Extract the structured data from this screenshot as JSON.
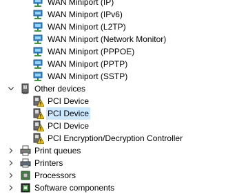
{
  "network_adapters": {
    "items": [
      {
        "label": "WAN Miniport (IP)"
      },
      {
        "label": "WAN Miniport (IPv6)"
      },
      {
        "label": "WAN Miniport (L2TP)"
      },
      {
        "label": "WAN Miniport (Network Monitor)"
      },
      {
        "label": "WAN Miniport (PPPOE)"
      },
      {
        "label": "WAN Miniport (PPTP)"
      },
      {
        "label": "WAN Miniport (SSTP)"
      }
    ]
  },
  "other_devices": {
    "label": "Other devices",
    "items": [
      {
        "label": "PCI Device"
      },
      {
        "label": "PCI Device"
      },
      {
        "label": "PCI Device"
      },
      {
        "label": "PCI Encryption/Decryption Controller"
      }
    ]
  },
  "categories": [
    {
      "label": "Print queues",
      "icon": "print-queue-icon"
    },
    {
      "label": "Printers",
      "icon": "printer-icon"
    },
    {
      "label": "Processors",
      "icon": "processor-icon"
    },
    {
      "label": "Software components",
      "icon": "software-components-icon"
    }
  ],
  "colors": {
    "selection": "#cce8ff",
    "network_icon": "#2f8fd8",
    "warning": "#f2c200"
  }
}
